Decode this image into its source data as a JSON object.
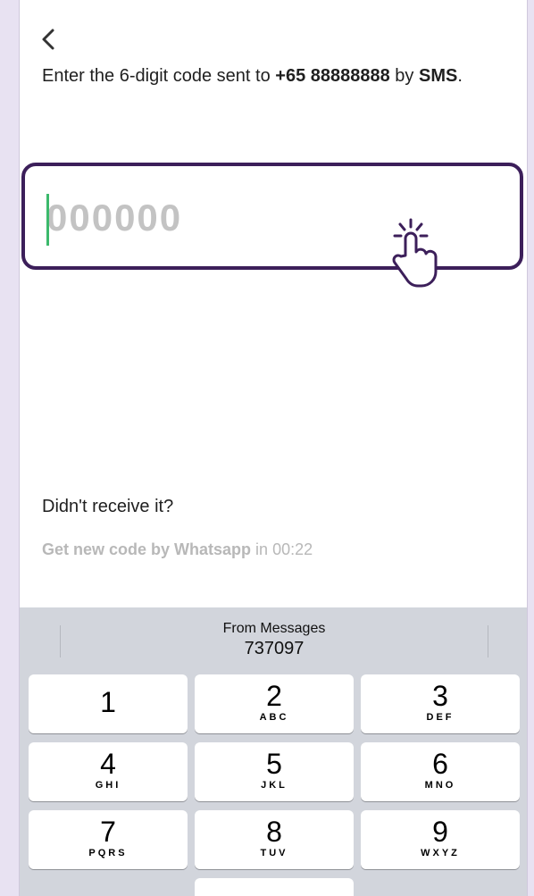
{
  "instruction": {
    "prefix": "Enter the 6-digit code sent to ",
    "phone": "+65 88888888",
    "middle": " by ",
    "channel": "SMS",
    "suffix": "."
  },
  "code_input": {
    "placeholder": "000000",
    "value": ""
  },
  "resend": {
    "title": "Didn't receive it?",
    "link_label": "Get new code by Whatsapp",
    "timer_prefix": " in ",
    "timer": "00:22"
  },
  "keyboard": {
    "suggestion_label": "From Messages",
    "suggestion_code": "737097",
    "keys": [
      {
        "digit": "1",
        "letters": ""
      },
      {
        "digit": "2",
        "letters": "ABC"
      },
      {
        "digit": "3",
        "letters": "DEF"
      },
      {
        "digit": "4",
        "letters": "GHI"
      },
      {
        "digit": "5",
        "letters": "JKL"
      },
      {
        "digit": "6",
        "letters": "MNO"
      },
      {
        "digit": "7",
        "letters": "PQRS"
      },
      {
        "digit": "8",
        "letters": "TUV"
      },
      {
        "digit": "9",
        "letters": "WXYZ"
      }
    ]
  },
  "icons": {
    "back": "chevron-left-icon",
    "tap_hint": "tap-hand-icon"
  },
  "colors": {
    "accent_border": "#3c1f5a",
    "caret": "#3cb96c",
    "background": "#e8e2f2",
    "muted_text": "#b8b8b8"
  }
}
